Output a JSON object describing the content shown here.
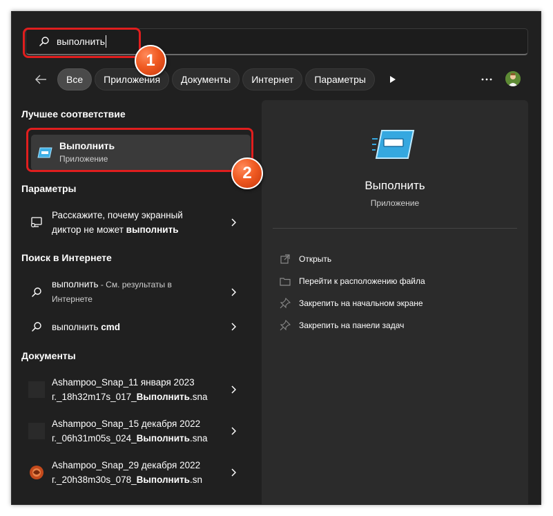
{
  "search": {
    "value": "выполнить"
  },
  "filters": {
    "items": [
      "Все",
      "Приложения",
      "Документы",
      "Интернет",
      "Параметры"
    ],
    "active": "Все"
  },
  "best_match": {
    "section_title": "Лучшее соответствие",
    "title": "Выполнить",
    "subtitle": "Приложение"
  },
  "settings": {
    "section_title": "Параметры",
    "item": {
      "line1": "Расскажите, почему экранный",
      "line2_plain": "диктор не может ",
      "line2_bold": "выполнить"
    }
  },
  "web_search": {
    "section_title": "Поиск в Интернете",
    "items": [
      {
        "text": "выполнить",
        "suffix": " - См. результаты в",
        "line2": "Интернете"
      },
      {
        "text": "выполнить ",
        "bold": "cmd"
      }
    ]
  },
  "documents": {
    "section_title": "Документы",
    "items": [
      {
        "line1": "Ashampoo_Snap_11 января 2023",
        "line2_pre": "г._18h32m17s_017_",
        "line2_bold": "Выполнить",
        "line2_post": ".sna"
      },
      {
        "line1": "Ashampoo_Snap_15 декабря 2022",
        "line2_pre": "г._06h31m05s_024_",
        "line2_bold": "Выполнить",
        "line2_post": ".sna"
      },
      {
        "line1": "Ashampoo_Snap_29 декабря 2022",
        "line2_pre": "г._20h38m30s_078_",
        "line2_bold": "Выполнить",
        "line2_post": ".sn"
      }
    ]
  },
  "details": {
    "title": "Выполнить",
    "subtitle": "Приложение",
    "actions": [
      "Открыть",
      "Перейти к расположению файла",
      "Закрепить на начальном экране",
      "Закрепить на панели задач"
    ]
  },
  "annotations": {
    "badge1": "1",
    "badge2": "2"
  },
  "colors": {
    "background": "#202020",
    "panel": "#2b2b2b",
    "accent": "#e01e1e",
    "badge": "#f05a22"
  }
}
